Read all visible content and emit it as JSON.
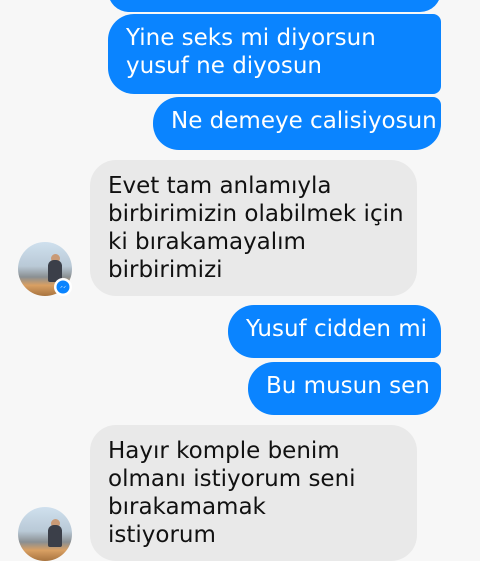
{
  "messages": [
    {
      "from": "me",
      "lines": []
    },
    {
      "from": "me",
      "lines": [
        "Yine seks mi diyorsun",
        "yusuf ne diyosun"
      ]
    },
    {
      "from": "me",
      "lines": [
        "Ne demeye calisiyosun"
      ]
    },
    {
      "from": "them",
      "lines": [
        "Evet tam anlamıyla",
        "birbirimizin olabilmek için",
        "ki bırakamayalım",
        "birbirimizi"
      ]
    },
    {
      "from": "me",
      "lines": [
        "Yusuf cidden mi"
      ]
    },
    {
      "from": "me",
      "lines": [
        "Bu musun sen"
      ]
    },
    {
      "from": "them",
      "lines": [
        "Hayır komple benim",
        "olmanı istiyorum seni",
        "bırakamamak",
        "istiyorum"
      ]
    }
  ],
  "avatar_icon": "messenger-badge-icon",
  "colors": {
    "sent": "#0a84ff",
    "received": "#e9e9e9",
    "background": "#f7f7f7"
  }
}
